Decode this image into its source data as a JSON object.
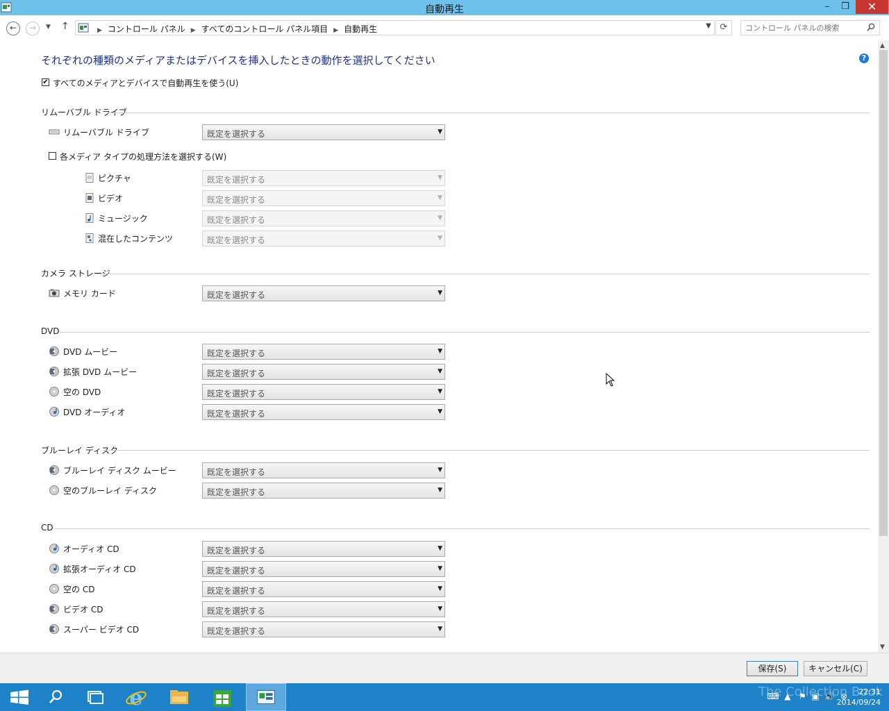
{
  "window": {
    "title": "自動再生",
    "controls": {
      "minimize": "–",
      "maximize": "❐",
      "close": "✕"
    }
  },
  "nav": {
    "breadcrumbs": [
      "コントロール パネル",
      "すべてのコントロール パネル項目",
      "自動再生"
    ],
    "search_placeholder": "コントロール パネルの検索"
  },
  "page": {
    "heading": "それぞれの種類のメディアまたはデバイスを挿入したときの動作を選択してください",
    "use_autoplay_label": "すべてのメディアとデバイスで自動再生を使う(U)",
    "use_autoplay_checked": true
  },
  "sections": {
    "removable": {
      "title": "リムーバブル ドライブ",
      "drive_label": "リムーバブル ドライブ",
      "drive_value": "既定を選択する",
      "per_media_label": "各メディア タイプの処理方法を選択する(W)",
      "per_media_checked": false,
      "media": [
        {
          "label": "ピクチャ",
          "value": "既定を選択する",
          "icon": "picture-icon"
        },
        {
          "label": "ビデオ",
          "value": "既定を選択する",
          "icon": "video-icon"
        },
        {
          "label": "ミュージック",
          "value": "既定を選択する",
          "icon": "music-icon"
        },
        {
          "label": "混在したコンテンツ",
          "value": "既定を選択する",
          "icon": "mixed-content-icon"
        }
      ]
    },
    "camera": {
      "title": "カメラ ストレージ",
      "items": [
        {
          "label": "メモリ カード",
          "value": "既定を選択する",
          "icon": "camera-icon"
        }
      ]
    },
    "dvd": {
      "title": "DVD",
      "items": [
        {
          "label": "DVD ムービー",
          "value": "既定を選択する",
          "icon": "dvd-movie-icon"
        },
        {
          "label": "拡張 DVD ムービー",
          "value": "既定を選択する",
          "icon": "dvd-enhanced-icon"
        },
        {
          "label": "空の DVD",
          "value": "既定を選択する",
          "icon": "blank-disc-icon"
        },
        {
          "label": "DVD オーディオ",
          "value": "既定を選択する",
          "icon": "audio-disc-icon"
        }
      ]
    },
    "bluray": {
      "title": "ブルーレイ ディスク",
      "items": [
        {
          "label": "ブルーレイ ディスク ムービー",
          "value": "既定を選択する",
          "icon": "bluray-movie-icon"
        },
        {
          "label": "空のブルーレイ ディスク",
          "value": "既定を選択する",
          "icon": "blank-disc-icon"
        }
      ]
    },
    "cd": {
      "title": "CD",
      "items": [
        {
          "label": "オーディオ CD",
          "value": "既定を選択する",
          "icon": "audio-disc-icon"
        },
        {
          "label": "拡張オーディオ CD",
          "value": "既定を選択する",
          "icon": "audio-disc-icon"
        },
        {
          "label": "空の CD",
          "value": "既定を選択する",
          "icon": "blank-disc-icon"
        },
        {
          "label": "ビデオ CD",
          "value": "既定を選択する",
          "icon": "video-disc-icon"
        },
        {
          "label": "スーパー ビデオ CD",
          "value": "既定を選択する",
          "icon": "video-disc-icon"
        }
      ]
    }
  },
  "footer": {
    "save": "保存(S)",
    "cancel": "キャンセル(C)"
  },
  "taskbar": {
    "time": "22:31",
    "date": "2014/09/24",
    "watermark": "The Collection Book"
  },
  "colors": {
    "titlebar": "#6ec1ea",
    "heading": "#1e3287",
    "taskbar": "#1e82c8",
    "close_button": "#c7372f"
  }
}
